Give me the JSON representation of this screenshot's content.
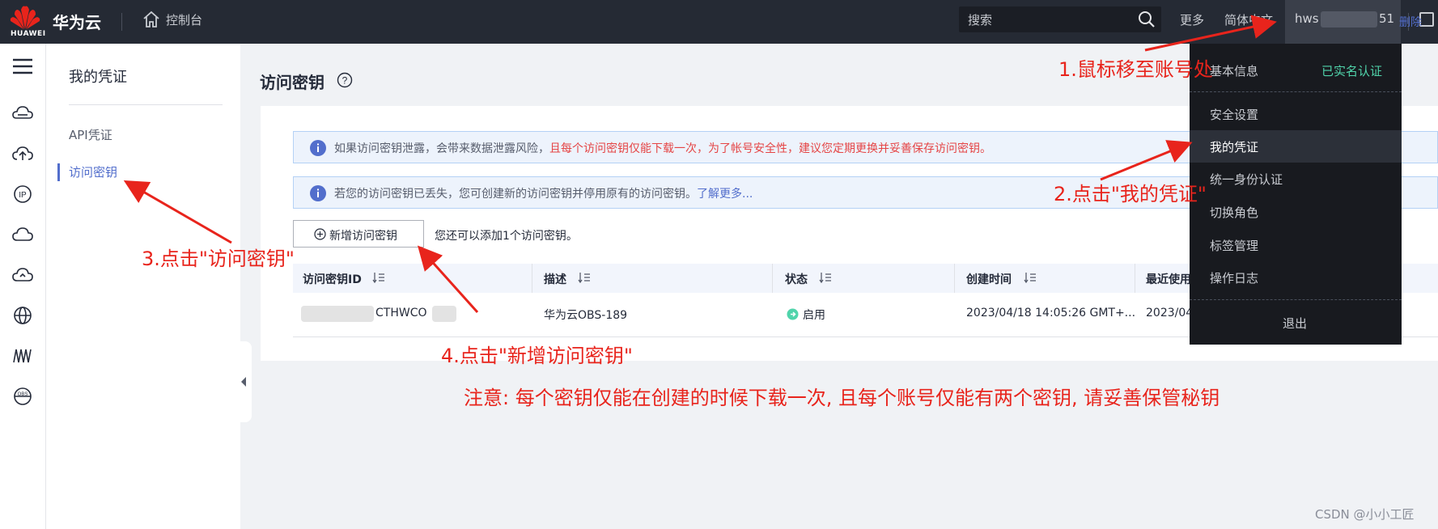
{
  "topbar": {
    "logo_text": "HUAWEI",
    "brand": "华为云",
    "console_label": "控制台",
    "search_placeholder": "搜索",
    "more": "更多",
    "language": "简体中文",
    "account_prefix": "hws",
    "account_suffix": "51"
  },
  "rail": {
    "icons": [
      "menu-icon",
      "cloud-server-icon",
      "cloud-upload-icon",
      "ip-icon",
      "cloud-icon",
      "cloud-arrow-icon",
      "globe-icon",
      "cluster-icon",
      "obs-globe-icon"
    ]
  },
  "subnav": {
    "title": "我的凭证",
    "items": [
      {
        "label": "API凭证",
        "active": false
      },
      {
        "label": "访问密钥",
        "active": true
      }
    ]
  },
  "main": {
    "title": "访问密钥",
    "alert1_text": "如果访问密钥泄露，会带来数据泄露风险，",
    "alert1_warn": "且每个访问密钥仅能下载一次，为了帐号安全性，建议您定期更换并妥善保存访问密钥。",
    "alert2_text": "若您的访问密钥已丢失，您可创建新的访问密钥并停用原有的访问密钥。",
    "alert2_link": "了解更多...",
    "add_button": "新增访问密钥",
    "quota_text": "您还可以添加1个访问密钥。",
    "table": {
      "columns": [
        "访问密钥ID",
        "描述",
        "状态",
        "创建时间",
        "最近使用"
      ],
      "rows": [
        {
          "id_visible": "CTHWCO",
          "description": "华为云OBS-189",
          "status": "启用",
          "created": "2023/04/18 14:05:26 GMT+...",
          "last_used": "2023/04",
          "action": "删除"
        }
      ]
    }
  },
  "dropdown": {
    "basic_info": "基本信息",
    "verified": "已实名认证",
    "items": [
      "安全设置",
      "我的凭证",
      "统一身份认证",
      "切换角色",
      "标签管理",
      "操作日志"
    ],
    "active_item": "我的凭证",
    "logout": "退出"
  },
  "annotations": {
    "step1": "1.鼠标移至账号处",
    "step2": "2.点击\"我的凭证\"",
    "step3": "3.点击\"访问密钥\"",
    "step4": "4.点击\"新增访问密钥\"",
    "note": "注意: 每个密钥仅能在创建的时候下载一次, 且每个账号仅能有两个密钥, 请妥善保管秘钥"
  },
  "watermark": "CSDN @小小工匠",
  "colors": {
    "topbar_bg": "#252a34",
    "accent": "#526ecc",
    "warning_red": "#e54545",
    "annotation_red": "#e8241c",
    "verified_green": "#50d4ab",
    "status_green": "#50d4ab"
  }
}
